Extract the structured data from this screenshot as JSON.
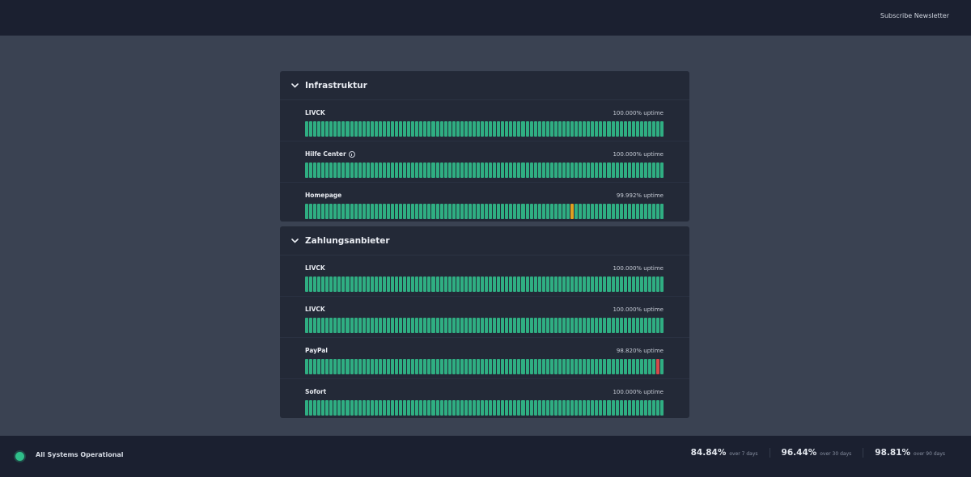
{
  "header": {
    "subscribe_label": "Subscribe Newsletter"
  },
  "groups": [
    {
      "title": "Infrastruktur",
      "services": [
        {
          "name": "LIVCK",
          "uptime": "100.000% uptime",
          "info": false,
          "warn_bars": [],
          "down_bars": []
        },
        {
          "name": "Hilfe Center",
          "uptime": "100.000% uptime",
          "info": true,
          "warn_bars": [],
          "down_bars": []
        },
        {
          "name": "Homepage",
          "uptime": "99.992% uptime",
          "info": false,
          "warn_bars": [
            65
          ],
          "down_bars": []
        }
      ]
    },
    {
      "title": "Zahlungsanbieter",
      "services": [
        {
          "name": "LIVCK",
          "uptime": "100.000% uptime",
          "info": false,
          "warn_bars": [],
          "down_bars": []
        },
        {
          "name": "LIVCK",
          "uptime": "100.000% uptime",
          "info": false,
          "warn_bars": [],
          "down_bars": []
        },
        {
          "name": "PayPal",
          "uptime": "98.820% uptime",
          "info": false,
          "warn_bars": [],
          "down_bars": [
            86
          ]
        },
        {
          "name": "Sofort",
          "uptime": "100.000% uptime",
          "info": false,
          "warn_bars": [],
          "down_bars": []
        }
      ]
    }
  ],
  "bar_count": 88,
  "colors": {
    "up": "#2fae82",
    "warn": "#e0a020",
    "down": "#d44a4a"
  },
  "footer": {
    "status": "All Systems Operational",
    "stats": [
      {
        "value": "84.84%",
        "label": "over 7 days"
      },
      {
        "value": "96.44%",
        "label": "over 30 days"
      },
      {
        "value": "98.81%",
        "label": "over 90 days"
      }
    ]
  }
}
